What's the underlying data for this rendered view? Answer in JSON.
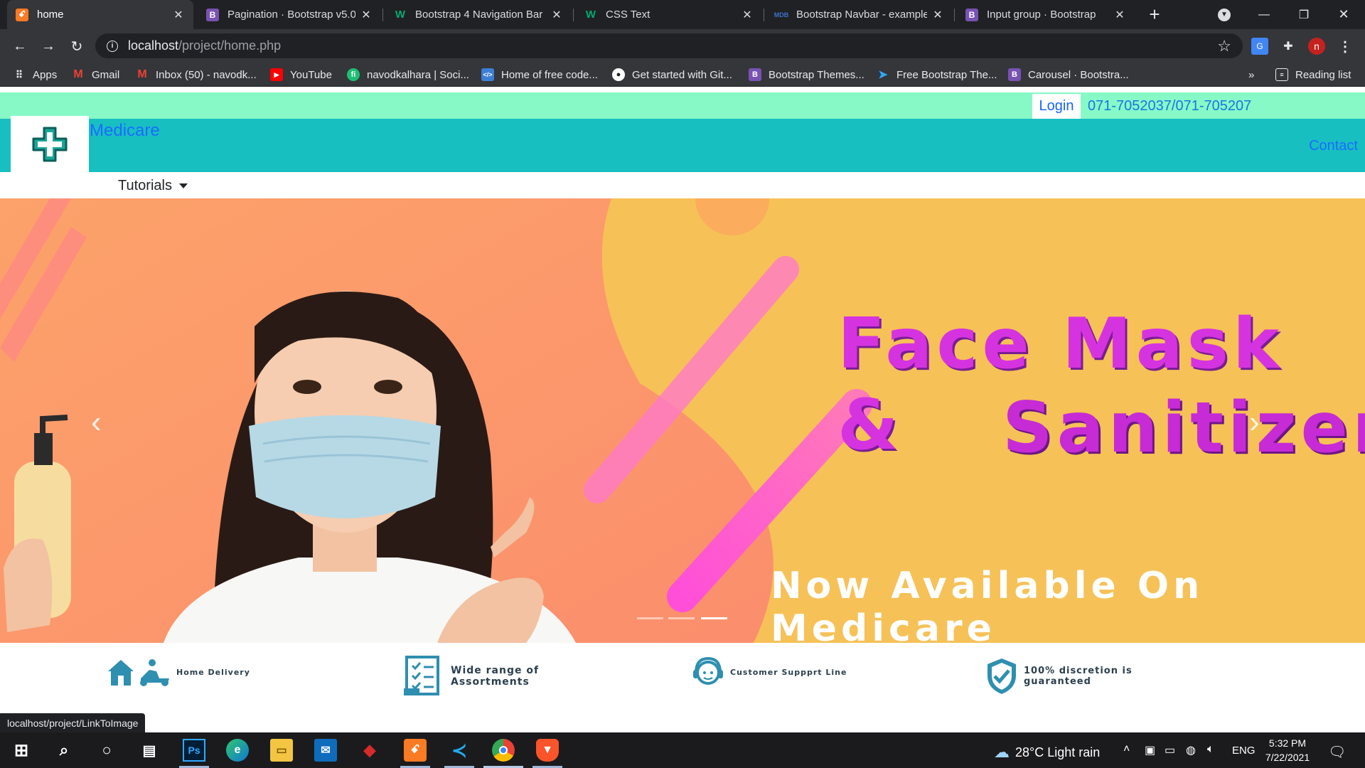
{
  "browser": {
    "tabs": [
      {
        "title": "home",
        "favicon": "xampp-icon",
        "active": true
      },
      {
        "title": "Pagination · Bootstrap v5.0",
        "favicon": "bootstrap-icon"
      },
      {
        "title": "Bootstrap 4 Navigation Bar",
        "favicon": "w3schools-icon"
      },
      {
        "title": "CSS Text",
        "favicon": "w3schools-icon"
      },
      {
        "title": "Bootstrap Navbar - example",
        "favicon": "mdb-icon"
      },
      {
        "title": "Input group · Bootstrap",
        "favicon": "bootstrap-icon"
      }
    ],
    "address": {
      "host": "localhost",
      "path": "/project/home.php"
    },
    "profile_initial": "n",
    "bookmarks": [
      {
        "label": "Apps",
        "icon": "apps-grid-icon"
      },
      {
        "label": "Gmail",
        "icon": "gmail-icon"
      },
      {
        "label": "Inbox (50) - navodk...",
        "icon": "gmail-icon"
      },
      {
        "label": "YouTube",
        "icon": "youtube-icon"
      },
      {
        "label": "navodkalhara | Soci...",
        "icon": "fiverr-icon"
      },
      {
        "label": "Home of free code...",
        "icon": "codepen-icon"
      },
      {
        "label": "Get started with Git...",
        "icon": "github-icon"
      },
      {
        "label": "Bootstrap Themes...",
        "icon": "bootstrap-icon"
      },
      {
        "label": "Free Bootstrap The...",
        "icon": "flag-icon"
      },
      {
        "label": "Carousel · Bootstra...",
        "icon": "bootstrap-icon"
      }
    ],
    "bookmarks_overflow": "»",
    "reading_list": "Reading list",
    "status_url": "localhost/project/LinkToImage"
  },
  "page": {
    "login_label": "Login",
    "phone": "071-7052037/071-705207",
    "brand": "Medicare",
    "contact_label": "Contact",
    "menu": {
      "tutorials_label": "Tutorials"
    },
    "carousel": {
      "line1": "Face Mask &",
      "line2": "Sanitizer",
      "line3": "Now Available On Medicare",
      "prev_label": "‹",
      "next_label": "›",
      "indicator_count": 3,
      "active_indicator": 3
    },
    "features": [
      {
        "label": "Home Delivery",
        "icon": "delivery-icon"
      },
      {
        "label_line1": "Wide range of",
        "label_line2": "Assortments",
        "icon": "checklist-icon"
      },
      {
        "label": "Customer Suppprt Line",
        "icon": "headset-icon"
      },
      {
        "label_line1": "100% discretion is",
        "label_line2": "guaranteed",
        "icon": "shield-check-icon"
      }
    ]
  },
  "taskbar": {
    "weather": "28°C  Light rain",
    "language": "ENG",
    "time": "5:32 PM",
    "date": "7/22/2021"
  },
  "colors": {
    "topbar": "#86f9c6",
    "header": "#18bfc1",
    "hero_bg": "#f6c157",
    "hero_text": "#d633e0",
    "link_blue": "#1a6cff"
  }
}
